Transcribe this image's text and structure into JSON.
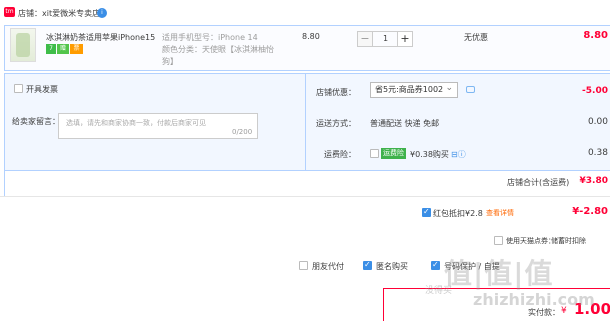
{
  "store": {
    "logo_text": "tm",
    "label": "店铺：xit爱微米专卖店",
    "badge": "i"
  },
  "item": {
    "title": "冰淇淋奶茶适用苹果iPhone15...",
    "service_icons": [
      "7",
      "赠",
      "票"
    ],
    "sku_model": "适用手机型号：iPhone 14",
    "sku_color_1": "颜色分类：天使眼【冰淇淋柚怡",
    "sku_color_2": "狗】",
    "unit_price": "8.80",
    "qty_minus": "−",
    "qty_value": "1",
    "qty_plus": "+",
    "discount": "无优惠",
    "subtotal": "8.80"
  },
  "invoice": {
    "label": "开具发票"
  },
  "message": {
    "label": "给卖家留言：",
    "placeholder": "选填，请先和商家协商一致，付款后商家可见",
    "count": "0/200"
  },
  "promo": {
    "label": "店铺优惠：",
    "selected": "省5元:商品券1002",
    "amount": "-5.00"
  },
  "shipping": {
    "label": "运送方式：",
    "value": "普通配送 快递 免邮",
    "amount": "0.00"
  },
  "insurance": {
    "label": "运费险：",
    "tag": "运费险",
    "text": "¥0.38购买",
    "icons": "⊟ⓘ",
    "amount": "0.38"
  },
  "store_total": {
    "label": "店铺合计(含运费)",
    "amount": "¥3.80"
  },
  "redpack": {
    "text": "红包抵扣¥2.8",
    "link": "查看详情",
    "amount": "¥-2.80"
  },
  "tmall_points": {
    "text": "使用天猫点券：",
    "right": "储蓄时扣除"
  },
  "options": {
    "friend": "朋友代付",
    "anonymous": "匿名购买",
    "address": "号码保护 / 自提"
  },
  "payment": {
    "label": "实付款：",
    "currency": "¥",
    "amount": "1.00"
  },
  "watermark": {
    "main": "值|值|值",
    "sub": "没得买",
    "url": "zhizhizhi.com",
    "small": "Meiles"
  }
}
